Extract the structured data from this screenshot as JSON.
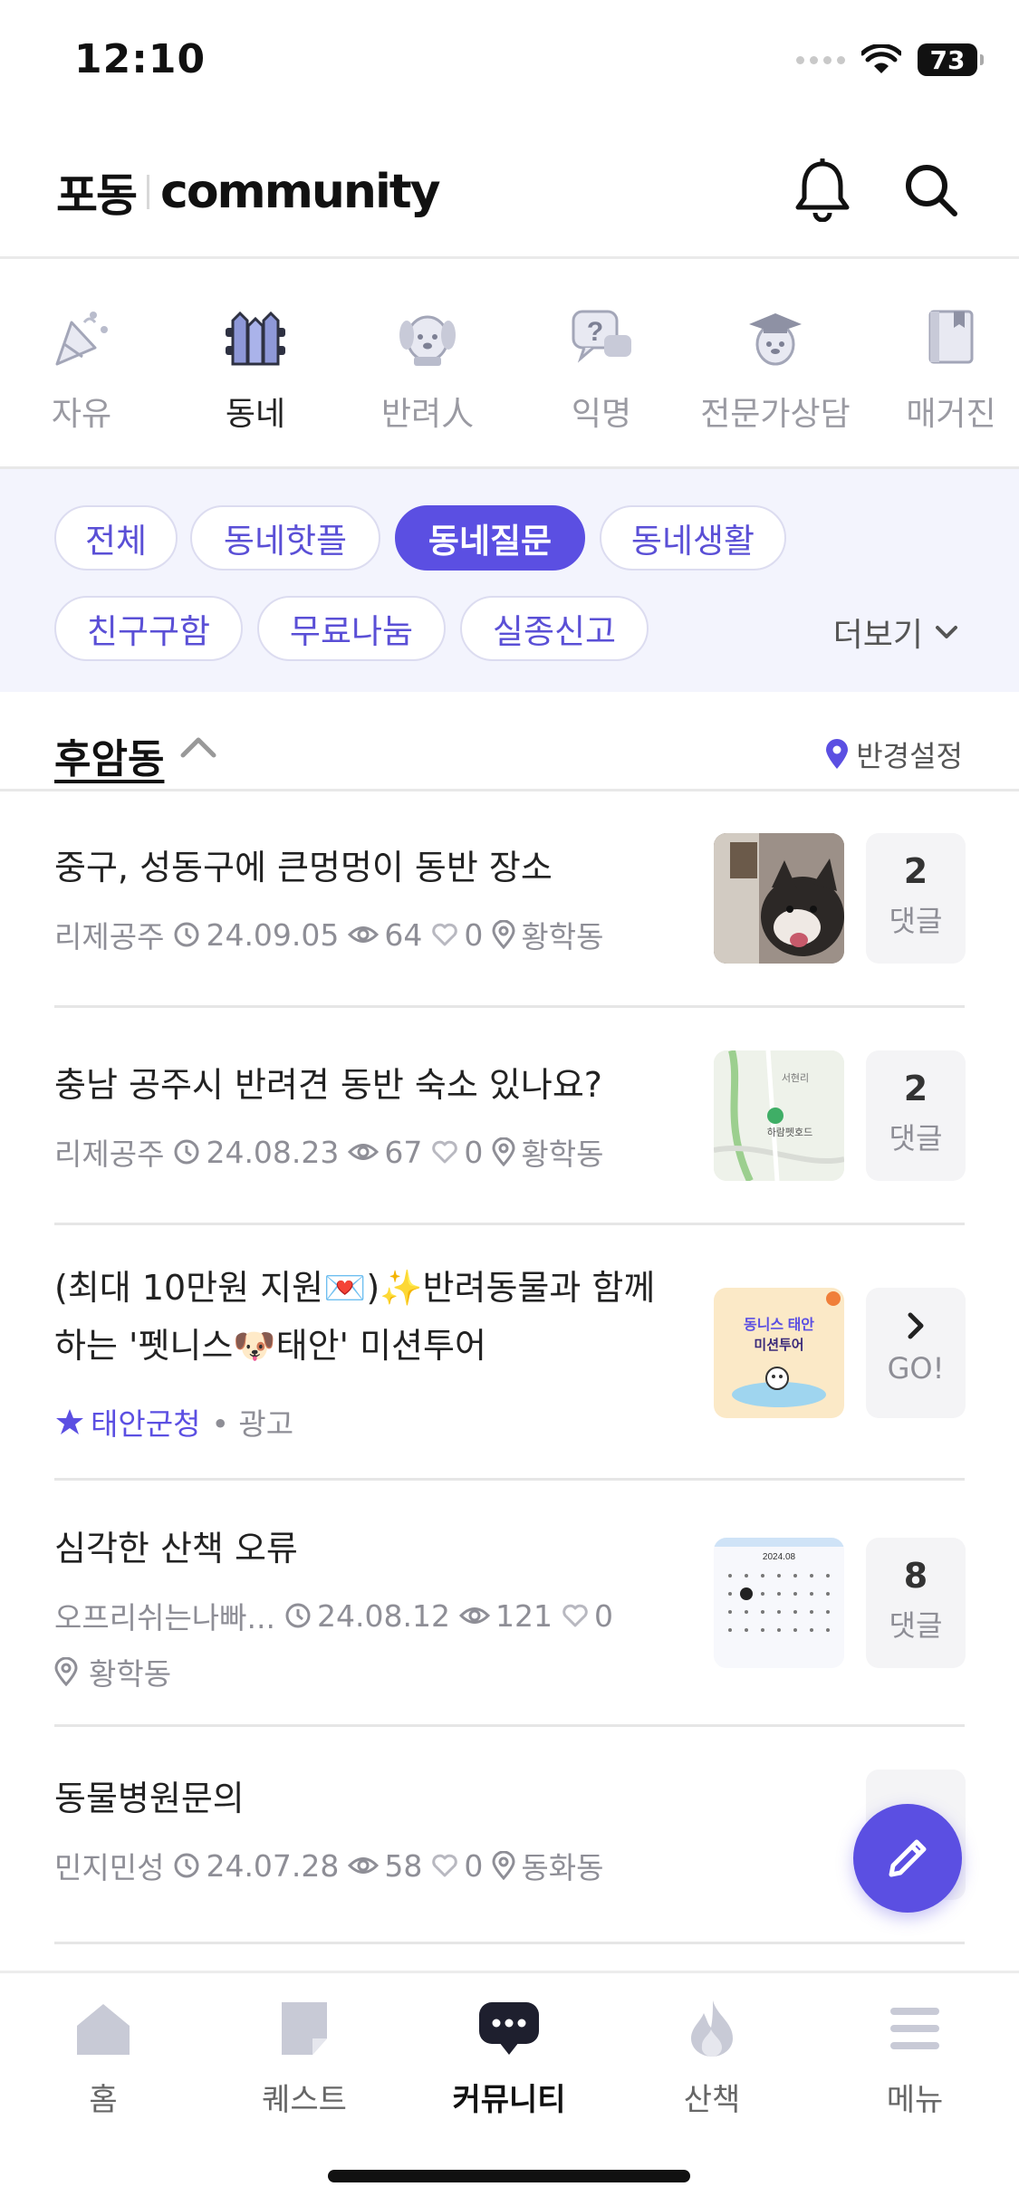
{
  "status_bar": {
    "time": "12:10",
    "battery": "73"
  },
  "header": {
    "logo_ko": "포동",
    "logo_en": "community"
  },
  "categories": [
    {
      "label": "자유",
      "icon": "party-icon",
      "active": false
    },
    {
      "label": "동네",
      "icon": "fence-icon",
      "active": true
    },
    {
      "label": "반려人",
      "icon": "dog-face-icon",
      "active": false
    },
    {
      "label": "익명",
      "icon": "question-bubble-icon",
      "active": false
    },
    {
      "label": "전문가상담",
      "icon": "graduate-dog-icon",
      "active": false
    },
    {
      "label": "매거진",
      "icon": "book-icon",
      "active": false
    }
  ],
  "chips": [
    {
      "label": "전체",
      "active": false
    },
    {
      "label": "동네핫플",
      "active": false
    },
    {
      "label": "동네질문",
      "active": true
    },
    {
      "label": "동네생활",
      "active": false
    },
    {
      "label": "친구구함",
      "active": false
    },
    {
      "label": "무료나눔",
      "active": false
    },
    {
      "label": "실종신고",
      "active": false
    }
  ],
  "more_label": "더보기",
  "location": {
    "name": "후암동",
    "radius_label": "반경설정"
  },
  "posts": [
    {
      "title": "중구, 성동구에 큰멍멍이 동반 장소",
      "author": "리제공주",
      "date": "24.09.05",
      "views": "64",
      "likes": "0",
      "place": "황학동",
      "count": "2",
      "count_label": "댓글"
    },
    {
      "title": "충남 공주시 반려견 동반 숙소 있나요?",
      "author": "리제공주",
      "date": "24.08.23",
      "views": "67",
      "likes": "0",
      "place": "황학동",
      "count": "2",
      "count_label": "댓글"
    },
    {
      "title_line1": "(최대 10만원 지원💌)✨반려동물과 함께",
      "title_line2": "하는 '펫니스🐶태안' 미션투어",
      "advertiser": "태안군청",
      "ad_label": "• 광고",
      "go_label": "GO!"
    },
    {
      "title": "심각한 산책 오류",
      "author": "오프리쉬는나빠...",
      "date": "24.08.12",
      "views": "121",
      "likes": "0",
      "place": "황학동",
      "count": "8",
      "count_label": "댓글"
    },
    {
      "title": "동물병원문의",
      "author": "민지민성",
      "date": "24.07.28",
      "views": "58",
      "likes": "0",
      "place": "동화동"
    }
  ],
  "thumbs": {
    "map_label": "서현리",
    "map_place": "하람펫호드",
    "ad_title": "동니스 태안",
    "ad_sub": "미션투어",
    "cal_month": "2024.08"
  },
  "bottom_nav": [
    {
      "label": "홈",
      "icon": "home-icon",
      "active": false
    },
    {
      "label": "퀘스트",
      "icon": "quest-note-icon",
      "active": false
    },
    {
      "label": "커뮤니티",
      "icon": "chat-bubble-icon",
      "active": true
    },
    {
      "label": "산책",
      "icon": "flame-icon",
      "active": false
    },
    {
      "label": "메뉴",
      "icon": "hamburger-icon",
      "active": false
    }
  ],
  "colors": {
    "accent": "#5b4fe2",
    "chip_bg": "#f3f4fd",
    "muted": "#8e8e96"
  }
}
